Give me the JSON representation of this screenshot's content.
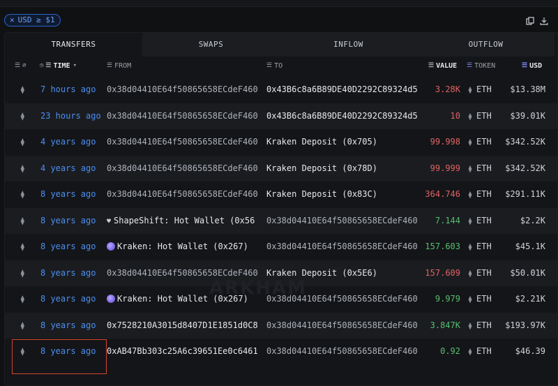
{
  "filter": {
    "close": "✕",
    "label": "USD ≥ $1"
  },
  "icons": {
    "copy": "copy-icon",
    "download": "download-icon",
    "chain": "ethereum-icon"
  },
  "tabs": [
    {
      "label": "TRANSFERS",
      "active": true
    },
    {
      "label": "SWAPS",
      "active": false
    },
    {
      "label": "INFLOW",
      "active": false
    },
    {
      "label": "OUTFLOW",
      "active": false
    }
  ],
  "columns": {
    "time": "TIME",
    "from": "FROM",
    "to": "TO",
    "value": "VALUE",
    "token": "TOKEN",
    "usd": "USD"
  },
  "watermark": "ARKHAM",
  "rows": [
    {
      "time": "7 hours ago",
      "from": "0x38d04410E64f50865658ECdeF460",
      "to": "0x43B6c8a6B89DE40D2292C89324d5",
      "value": "3.28K",
      "token": "ETH",
      "usd": "$13.38M"
    },
    {
      "time": "23 hours ago",
      "from": "0x38d04410E64f50865658ECdeF460",
      "to": "0x43B6c8a6B89DE40D2292C89324d5",
      "value": "10",
      "token": "ETH",
      "usd": "$39.01K"
    },
    {
      "time": "4 years ago",
      "from": "0x38d04410E64f50865658ECdeF460",
      "to": "Kraken Deposit (0x705)",
      "value": "99.998",
      "token": "ETH",
      "usd": "$342.52K"
    },
    {
      "time": "4 years ago",
      "from": "0x38d04410E64f50865658ECdeF460",
      "to": "Kraken Deposit (0x78D)",
      "value": "99.999",
      "token": "ETH",
      "usd": "$342.52K"
    },
    {
      "time": "8 years ago",
      "from": "0x38d04410E64f50865658ECdeF460",
      "to": "Kraken Deposit (0x83C)",
      "value": "364.746",
      "token": "ETH",
      "usd": "$291.11K"
    },
    {
      "time": "8 years ago",
      "from": "ShapeShift: Hot Wallet (0x56",
      "to": "0x38d04410E64f50865658ECdeF460",
      "value": "7.144",
      "token": "ETH",
      "usd": "$2.2K"
    },
    {
      "time": "8 years ago",
      "from": "Kraken: Hot Wallet (0x267)",
      "to": "0x38d04410E64f50865658ECdeF460",
      "value": "157.603",
      "token": "ETH",
      "usd": "$45.1K"
    },
    {
      "time": "8 years ago",
      "from": "0x38d04410E64f50865658ECdeF460",
      "to": "Kraken Deposit (0x5E6)",
      "value": "157.609",
      "token": "ETH",
      "usd": "$50.01K"
    },
    {
      "time": "8 years ago",
      "from": "Kraken: Hot Wallet (0x267)",
      "to": "0x38d04410E64f50865658ECdeF460",
      "value": "9.979",
      "token": "ETH",
      "usd": "$2.21K"
    },
    {
      "time": "8 years ago",
      "from": "0x7528210A3015d8407D1E1851d0C8",
      "to": "0x38d04410E64f50865658ECdeF460",
      "value": "3.847K",
      "token": "ETH",
      "usd": "$193.97K"
    },
    {
      "time": "8 years ago",
      "from": "0xAB47Bb303c25A6c39651Ee0c6461",
      "to": "0x38d04410E64f50865658ECdeF460",
      "value": "0.92",
      "token": "ETH",
      "usd": "$46.39"
    }
  ]
}
